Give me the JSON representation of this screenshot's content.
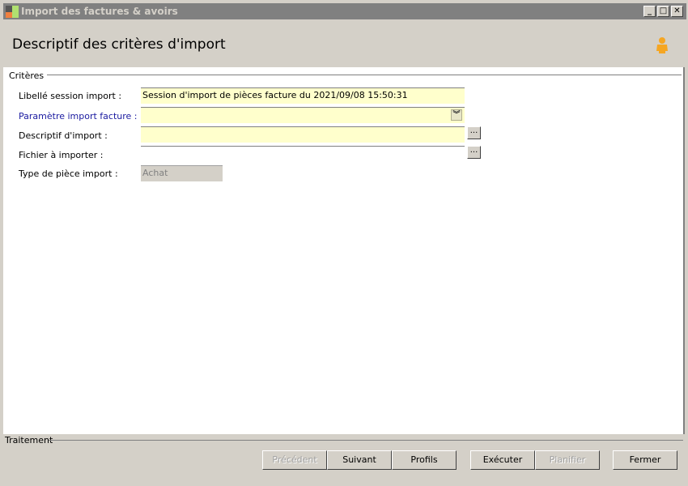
{
  "window": {
    "title": "Import des factures & avoirs",
    "minimize": "_",
    "maximize": "□",
    "close": "✕"
  },
  "header": {
    "title": "Descriptif des critères d'import",
    "icon": "user-icon"
  },
  "criteria": {
    "group_label": "Critères",
    "fields": [
      {
        "label": "Libellé session import :",
        "value": "Session d'import de pièces facture du 2021/09/08 15:50:31"
      },
      {
        "label": "Paramètre import facture :",
        "value": ""
      },
      {
        "label": "Descriptif d'import :",
        "value": "",
        "button": "..."
      },
      {
        "label": "Fichier à importer :",
        "value": "",
        "button": "..."
      },
      {
        "label": "Type de pièce import :",
        "value": "Achat"
      }
    ]
  },
  "footer": {
    "group_label": "Traitement",
    "buttons": [
      {
        "label": "Précédent",
        "enabled": false
      },
      {
        "label": "Suivant",
        "enabled": true
      },
      {
        "label": "Profils",
        "enabled": true
      },
      {
        "label": "Exécuter",
        "enabled": true
      },
      {
        "label": "Planifier",
        "enabled": false
      },
      {
        "label": "Fermer",
        "enabled": true
      }
    ]
  }
}
